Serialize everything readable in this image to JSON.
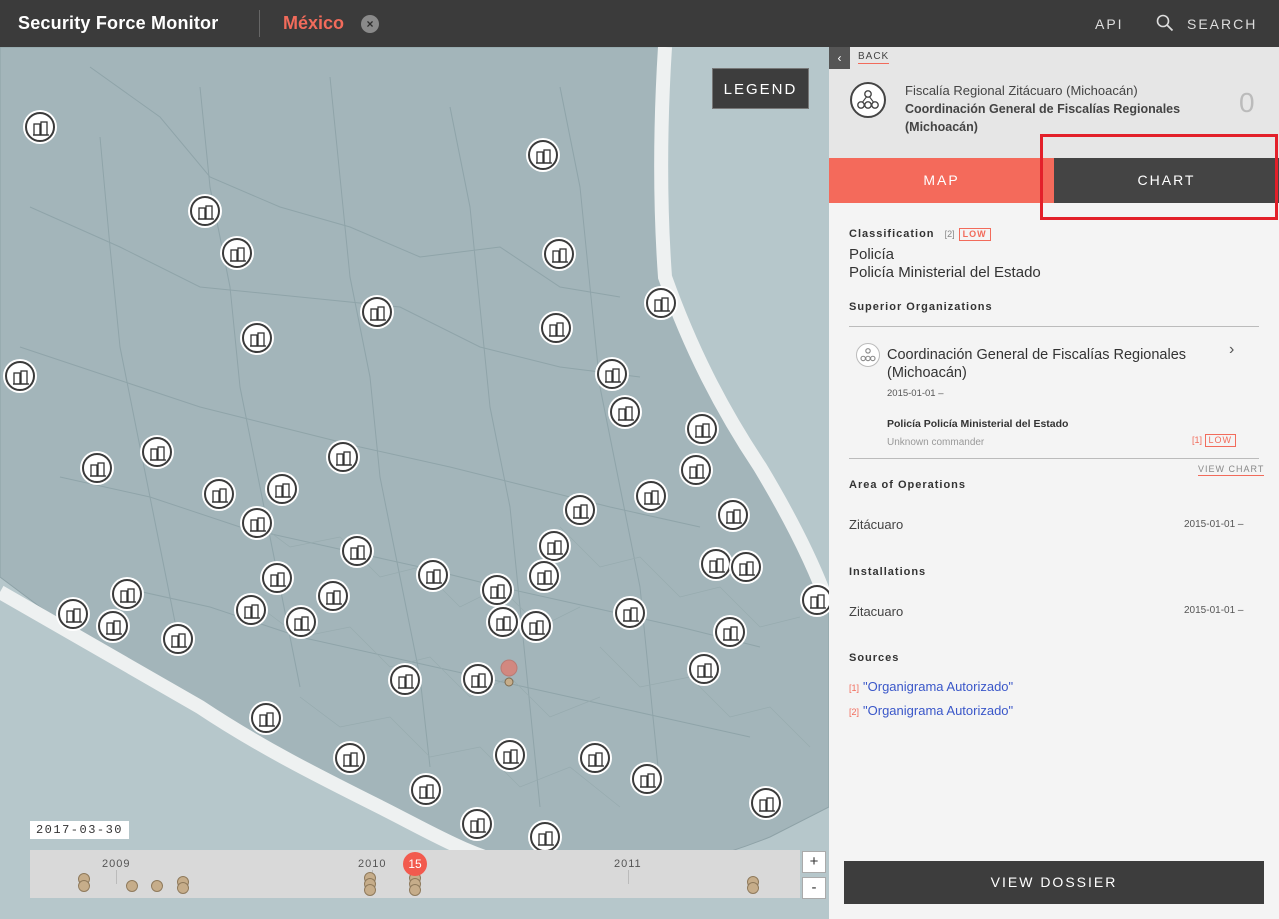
{
  "topbar": {
    "brand": "Security Force Monitor",
    "country": "México",
    "close_icon": "×",
    "api": "API",
    "search": "SEARCH"
  },
  "map": {
    "legend_label": "LEGEND",
    "date": "2017-03-30",
    "timeline": {
      "years": [
        "2009",
        "2010",
        "2011"
      ],
      "active_count": "15",
      "zoom_in": "+",
      "zoom_out": "-"
    }
  },
  "panel": {
    "back_label": "BACK",
    "unit_name": "Fiscalía Regional Zitácuaro (Michoacán)",
    "parent_name": "Coordinación General de Fiscalías Regionales (Michoacán)",
    "count": "0",
    "tabs": {
      "map": "MAP",
      "chart": "CHART"
    },
    "classification": {
      "title": "Classification",
      "ref": "[2]",
      "confidence": "LOW",
      "values": [
        "Policía",
        "Policía Ministerial del Estado"
      ]
    },
    "superior": {
      "title": "Superior Organizations",
      "name": "Coordinación General de Fiscalías Regionales (Michoacán)",
      "date": "2015-01-01  –",
      "classification": "Policía  Policía Ministerial del Estado",
      "commander": "Unknown commander",
      "ref": "[1]",
      "confidence": "LOW",
      "view_chart": "VIEW CHART"
    },
    "area": {
      "title": "Area of Operations",
      "name": "Zitácuaro",
      "date": "2015-01-01  –"
    },
    "installations": {
      "title": "Installations",
      "name": "Zitacuaro",
      "date": "2015-01-01  –"
    },
    "sources": {
      "title": "Sources",
      "items": [
        {
          "ref": "[1]",
          "label": "\"Organigrama Autorizado\""
        },
        {
          "ref": "[2]",
          "label": "\"Organigrama Autorizado\""
        }
      ]
    },
    "dossier_button": "VIEW DOSSIER"
  },
  "colors": {
    "accent": "#f46a5b",
    "topbar": "#3b3b3b",
    "highlight": "#e3202a",
    "link": "#3a57c9"
  },
  "icons": [
    "close-icon",
    "search-icon",
    "back-chevron-icon",
    "organization-icon",
    "chevron-right-icon",
    "building-marker-icon"
  ]
}
